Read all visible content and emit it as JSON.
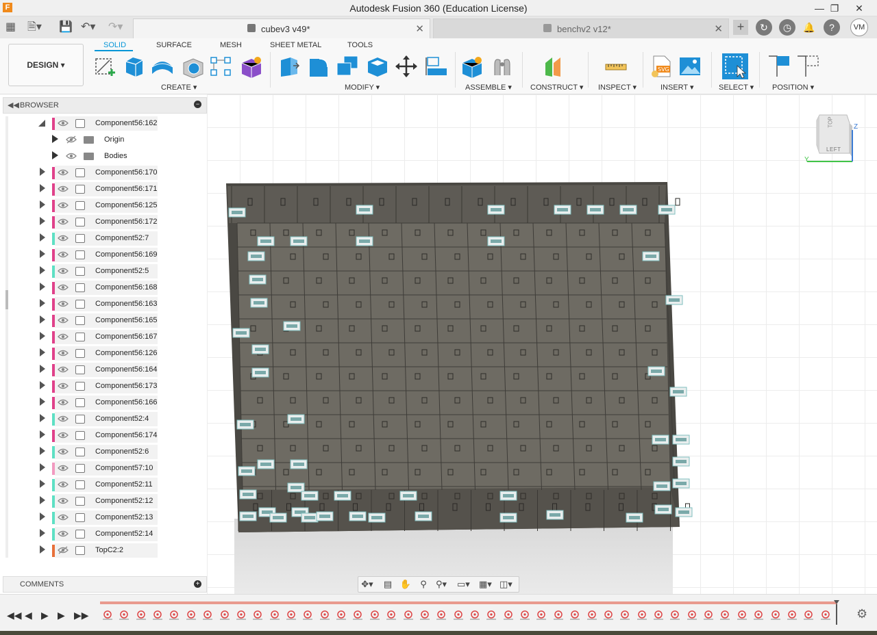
{
  "window": {
    "title": "Autodesk Fusion 360 (Education License)",
    "logo": "F",
    "controls": [
      "minimize-icon",
      "restore-icon",
      "close-icon"
    ]
  },
  "tabs": [
    {
      "label": "cubev3 v49*",
      "active": true
    },
    {
      "label": "benchv2 v12*",
      "active": false
    }
  ],
  "user": {
    "initials": "VM"
  },
  "toolbar": {
    "workspace": "DESIGN",
    "workspace_tabs": [
      "SOLID",
      "SURFACE",
      "MESH",
      "SHEET METAL",
      "TOOLS"
    ],
    "active_tab": "SOLID",
    "groups": [
      {
        "label": "CREATE",
        "icons": [
          "create-sketch-icon",
          "extrude-icon",
          "revolve-icon",
          "hole-icon",
          "pattern-icon",
          "create-form-icon"
        ]
      },
      {
        "label": "MODIFY",
        "icons": [
          "press-pull-icon",
          "fillet-icon",
          "combine-icon",
          "shell-icon",
          "move-icon",
          "align-icon"
        ]
      },
      {
        "label": "ASSEMBLE",
        "icons": [
          "new-component-icon",
          "joint-icon"
        ]
      },
      {
        "label": "CONSTRUCT",
        "icons": [
          "offset-plane-icon"
        ]
      },
      {
        "label": "INSPECT",
        "icons": [
          "measure-icon"
        ]
      },
      {
        "label": "INSERT",
        "icons": [
          "insert-svg-icon",
          "canvas-icon"
        ]
      },
      {
        "label": "SELECT",
        "icons": [
          "select-icon"
        ]
      },
      {
        "label": "POSITION",
        "icons": [
          "capture-position-icon",
          "revert-position-icon"
        ]
      }
    ]
  },
  "browser": {
    "title": "BROWSER",
    "items": [
      {
        "name": "Component56:162",
        "color": "#e0418a",
        "expanded": true,
        "type": "component"
      },
      {
        "name": "Origin",
        "type": "folder",
        "hidden": true
      },
      {
        "name": "Bodies",
        "type": "folder"
      },
      {
        "name": "Component56:170",
        "color": "#e0418a",
        "type": "component"
      },
      {
        "name": "Component56:171",
        "color": "#e0418a",
        "type": "component"
      },
      {
        "name": "Component56:125",
        "color": "#e0418a",
        "type": "component"
      },
      {
        "name": "Component56:172",
        "color": "#e0418a",
        "type": "component"
      },
      {
        "name": "Component52:7",
        "color": "#5ee0c4",
        "type": "component"
      },
      {
        "name": "Component56:169",
        "color": "#e0418a",
        "type": "component"
      },
      {
        "name": "Component52:5",
        "color": "#5ee0c4",
        "type": "component"
      },
      {
        "name": "Component56:168",
        "color": "#e0418a",
        "type": "component"
      },
      {
        "name": "Component56:163",
        "color": "#e0418a",
        "type": "component"
      },
      {
        "name": "Component56:165",
        "color": "#e0418a",
        "type": "component"
      },
      {
        "name": "Component56:167",
        "color": "#e0418a",
        "type": "component"
      },
      {
        "name": "Component56:126",
        "color": "#e0418a",
        "type": "component"
      },
      {
        "name": "Component56:164",
        "color": "#e0418a",
        "type": "component"
      },
      {
        "name": "Component56:173",
        "color": "#e0418a",
        "type": "component"
      },
      {
        "name": "Component56:166",
        "color": "#e0418a",
        "type": "component"
      },
      {
        "name": "Component52:4",
        "color": "#5ee0c4",
        "type": "component"
      },
      {
        "name": "Component56:174",
        "color": "#e0418a",
        "type": "component"
      },
      {
        "name": "Component52:6",
        "color": "#5ee0c4",
        "type": "component"
      },
      {
        "name": "Component57:10",
        "color": "#f29ac0",
        "type": "component"
      },
      {
        "name": "Component52:11",
        "color": "#5ee0c4",
        "type": "component"
      },
      {
        "name": "Component52:12",
        "color": "#5ee0c4",
        "type": "component"
      },
      {
        "name": "Component52:13",
        "color": "#5ee0c4",
        "type": "component"
      },
      {
        "name": "Component52:14",
        "color": "#5ee0c4",
        "type": "component"
      },
      {
        "name": "TopC2:2",
        "color": "#e8703a",
        "type": "component",
        "hidden": true
      }
    ]
  },
  "comments": {
    "title": "COMMENTS"
  },
  "viewcube": {
    "face": "LEFT",
    "top_face": "TOP",
    "axis_z": "Z",
    "axis_y": "Y"
  },
  "navbar": {
    "icons": [
      "orbit-icon",
      "look-at-icon",
      "pan-icon",
      "zoom-icon",
      "fit-icon",
      "display-settings-icon",
      "grid-icon",
      "viewports-icon"
    ]
  },
  "timeline": {
    "controls": [
      "first-icon",
      "previous-icon",
      "play-icon",
      "next-icon",
      "last-icon"
    ],
    "feature_count": 44
  },
  "colors": {
    "accent": "#0696d7",
    "model": "#6e6b63",
    "model_dark": "#4a4843"
  }
}
